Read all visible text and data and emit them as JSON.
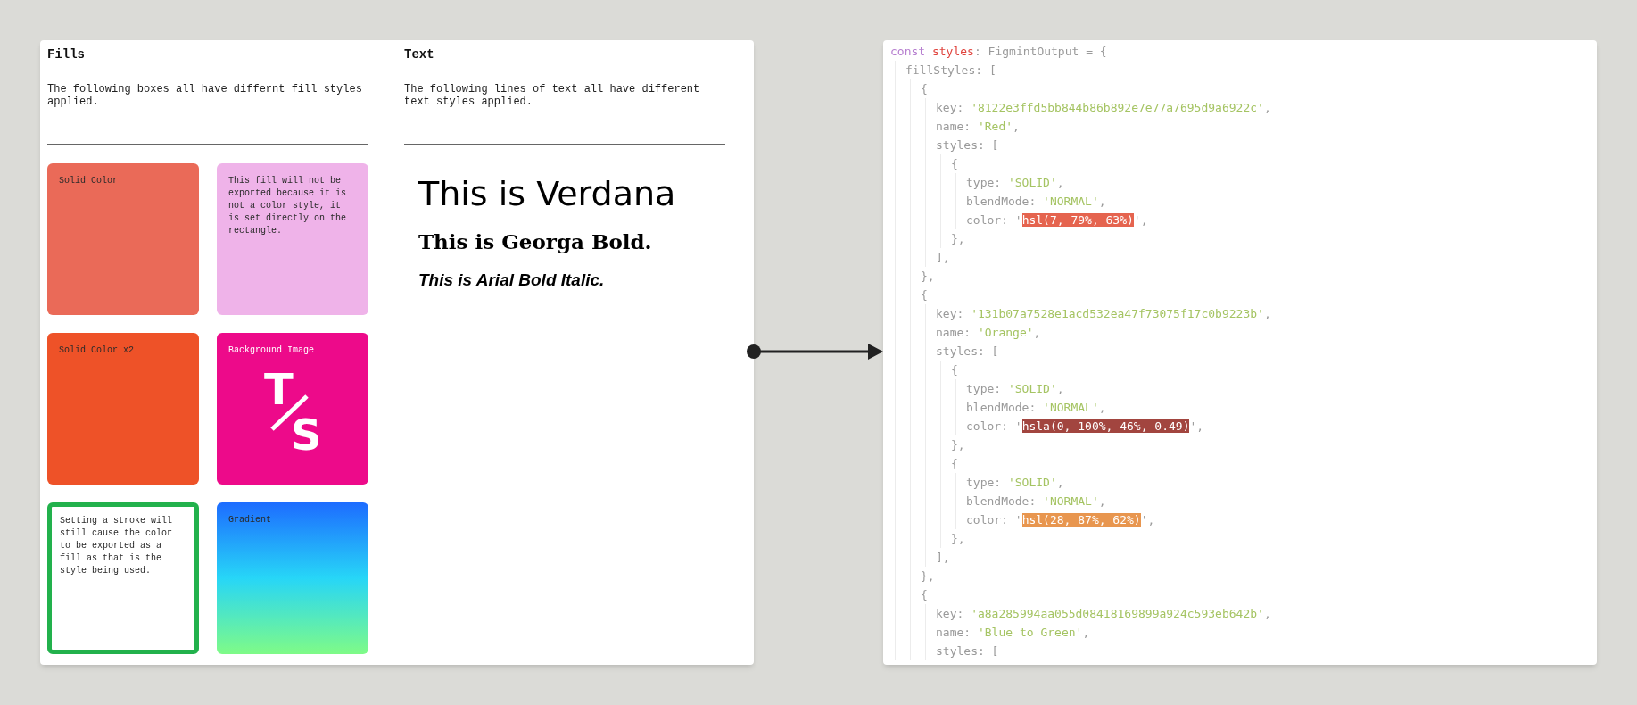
{
  "fills": {
    "heading": "Fills",
    "description": "The following boxes all have differnt fill styles applied.",
    "boxes": [
      {
        "kind": "solid",
        "label": "Solid Color",
        "color": "#ea6a58"
      },
      {
        "kind": "solid",
        "label": "This fill will not be exported because it is not a color style, it is set directly on the rectangle.",
        "color": "#efb3e9"
      },
      {
        "kind": "solid",
        "label": "Solid Color x2",
        "color": "#ee5228"
      },
      {
        "kind": "image",
        "label": "Background Image",
        "color": "#ed0a8a",
        "logo_top": "T",
        "logo_bottom": "S"
      },
      {
        "kind": "stroke",
        "label": "Setting a stroke will still cause the color to be exported as a fill as that is the style being used.",
        "color": "#22b14c"
      },
      {
        "kind": "gradient",
        "label": "Gradient",
        "color": "#1d6cff"
      }
    ]
  },
  "text": {
    "heading": "Text",
    "description": "The following lines of text all have different text styles applied.",
    "samples": [
      {
        "kind": "verdana",
        "text": "This is Verdana"
      },
      {
        "kind": "georgia-bold",
        "text": "This is Georga Bold."
      },
      {
        "kind": "arial-bold-italic",
        "text": "This is Arial Bold Italic."
      }
    ]
  },
  "code": [
    {
      "tokens": [
        {
          "t": "const ",
          "kind": "keyword"
        },
        {
          "t": "styles",
          "kind": "variable"
        },
        {
          "t": ": FigmintOutput = {",
          "kind": "plain"
        }
      ],
      "children": [
        {
          "tokens": [
            {
              "t": "fillStyles: [",
              "kind": "plain"
            }
          ],
          "children": [
            {
              "tokens": [
                {
                  "t": "{",
                  "kind": "plain"
                }
              ],
              "children": [
                {
                  "tokens": [
                    {
                      "t": "key: ",
                      "kind": "plain"
                    },
                    {
                      "t": "'8122e3ffd5bb844b86b892e7e77a7695d9a6922c'",
                      "kind": "string"
                    },
                    {
                      "t": ",",
                      "kind": "plain"
                    }
                  ]
                },
                {
                  "tokens": [
                    {
                      "t": "name: ",
                      "kind": "plain"
                    },
                    {
                      "t": "'Red'",
                      "kind": "string"
                    },
                    {
                      "t": ",",
                      "kind": "plain"
                    }
                  ]
                },
                {
                  "tokens": [
                    {
                      "t": "styles: [",
                      "kind": "plain"
                    }
                  ],
                  "children": [
                    {
                      "tokens": [
                        {
                          "t": "{",
                          "kind": "plain"
                        }
                      ],
                      "children": [
                        {
                          "tokens": [
                            {
                              "t": "type: ",
                              "kind": "plain"
                            },
                            {
                              "t": "'SOLID'",
                              "kind": "string"
                            },
                            {
                              "t": ",",
                              "kind": "plain"
                            }
                          ]
                        },
                        {
                          "tokens": [
                            {
                              "t": "blendMode: ",
                              "kind": "plain"
                            },
                            {
                              "t": "'NORMAL'",
                              "kind": "string"
                            },
                            {
                              "t": ",",
                              "kind": "plain"
                            }
                          ]
                        },
                        {
                          "tokens": [
                            {
                              "t": "color: '",
                              "kind": "plain"
                            },
                            {
                              "t": "hsl(7, 79%, 63%)",
                              "kind": "swatch",
                              "color": "#e5644f"
                            },
                            {
                              "t": "',",
                              "kind": "plain"
                            }
                          ]
                        }
                      ]
                    },
                    {
                      "tokens": [
                        {
                          "t": "},",
                          "kind": "plain"
                        }
                      ]
                    }
                  ]
                },
                {
                  "tokens": [
                    {
                      "t": "],",
                      "kind": "plain"
                    }
                  ]
                }
              ]
            },
            {
              "tokens": [
                {
                  "t": "},",
                  "kind": "plain"
                }
              ]
            },
            {
              "tokens": [
                {
                  "t": "{",
                  "kind": "plain"
                }
              ],
              "children": [
                {
                  "tokens": [
                    {
                      "t": "key: ",
                      "kind": "plain"
                    },
                    {
                      "t": "'131b07a7528e1acd532ea47f73075f17c0b9223b'",
                      "kind": "string"
                    },
                    {
                      "t": ",",
                      "kind": "plain"
                    }
                  ]
                },
                {
                  "tokens": [
                    {
                      "t": "name: ",
                      "kind": "plain"
                    },
                    {
                      "t": "'Orange'",
                      "kind": "string"
                    },
                    {
                      "t": ",",
                      "kind": "plain"
                    }
                  ]
                },
                {
                  "tokens": [
                    {
                      "t": "styles: [",
                      "kind": "plain"
                    }
                  ],
                  "children": [
                    {
                      "tokens": [
                        {
                          "t": "{",
                          "kind": "plain"
                        }
                      ],
                      "children": [
                        {
                          "tokens": [
                            {
                              "t": "type: ",
                              "kind": "plain"
                            },
                            {
                              "t": "'SOLID'",
                              "kind": "string"
                            },
                            {
                              "t": ",",
                              "kind": "plain"
                            }
                          ]
                        },
                        {
                          "tokens": [
                            {
                              "t": "blendMode: ",
                              "kind": "plain"
                            },
                            {
                              "t": "'NORMAL'",
                              "kind": "string"
                            },
                            {
                              "t": ",",
                              "kind": "plain"
                            }
                          ]
                        },
                        {
                          "tokens": [
                            {
                              "t": "color: '",
                              "kind": "plain"
                            },
                            {
                              "t": "hsla(0, 100%, 46%, 0.49)",
                              "kind": "swatch",
                              "color": "#a2453f"
                            },
                            {
                              "t": "',",
                              "kind": "plain"
                            }
                          ]
                        }
                      ]
                    },
                    {
                      "tokens": [
                        {
                          "t": "},",
                          "kind": "plain"
                        }
                      ]
                    },
                    {
                      "tokens": [
                        {
                          "t": "{",
                          "kind": "plain"
                        }
                      ],
                      "children": [
                        {
                          "tokens": [
                            {
                              "t": "type: ",
                              "kind": "plain"
                            },
                            {
                              "t": "'SOLID'",
                              "kind": "string"
                            },
                            {
                              "t": ",",
                              "kind": "plain"
                            }
                          ]
                        },
                        {
                          "tokens": [
                            {
                              "t": "blendMode: ",
                              "kind": "plain"
                            },
                            {
                              "t": "'NORMAL'",
                              "kind": "string"
                            },
                            {
                              "t": ",",
                              "kind": "plain"
                            }
                          ]
                        },
                        {
                          "tokens": [
                            {
                              "t": "color: '",
                              "kind": "plain"
                            },
                            {
                              "t": "hsl(28, 87%, 62%)",
                              "kind": "swatch",
                              "color": "#e8964f"
                            },
                            {
                              "t": "',",
                              "kind": "plain"
                            }
                          ]
                        }
                      ]
                    },
                    {
                      "tokens": [
                        {
                          "t": "},",
                          "kind": "plain"
                        }
                      ]
                    }
                  ]
                },
                {
                  "tokens": [
                    {
                      "t": "],",
                      "kind": "plain"
                    }
                  ]
                }
              ]
            },
            {
              "tokens": [
                {
                  "t": "},",
                  "kind": "plain"
                }
              ]
            },
            {
              "tokens": [
                {
                  "t": "{",
                  "kind": "plain"
                }
              ],
              "children": [
                {
                  "tokens": [
                    {
                      "t": "key: ",
                      "kind": "plain"
                    },
                    {
                      "t": "'a8a285994aa055d08418169899a924c593eb642b'",
                      "kind": "string"
                    },
                    {
                      "t": ",",
                      "kind": "plain"
                    }
                  ]
                },
                {
                  "tokens": [
                    {
                      "t": "name: ",
                      "kind": "plain"
                    },
                    {
                      "t": "'Blue to Green'",
                      "kind": "string"
                    },
                    {
                      "t": ",",
                      "kind": "plain"
                    }
                  ]
                },
                {
                  "tokens": [
                    {
                      "t": "styles: [",
                      "kind": "plain"
                    }
                  ]
                }
              ]
            }
          ]
        }
      ]
    }
  ]
}
